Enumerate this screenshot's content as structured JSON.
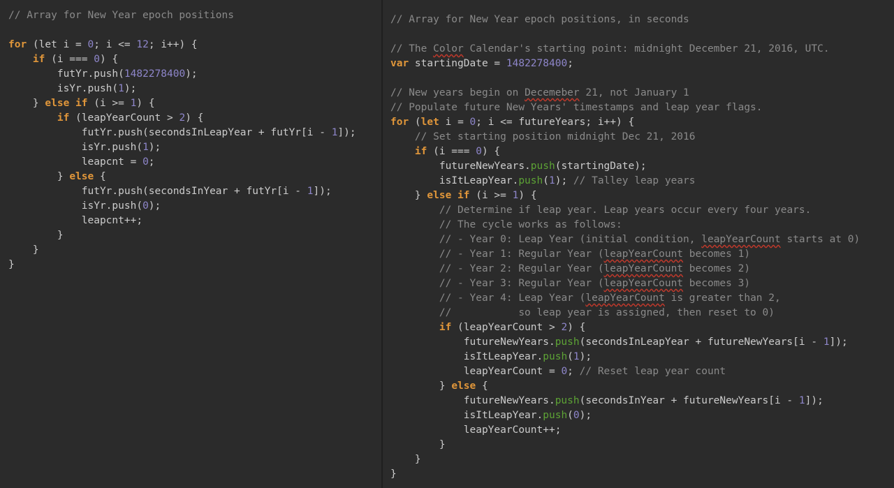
{
  "left_code": [
    [
      [
        "cm",
        "// Array for New Year epoch positions"
      ]
    ],
    [],
    [
      [
        "kw",
        "for"
      ],
      [
        "t",
        " (let i = "
      ],
      [
        "num",
        "0"
      ],
      [
        "t",
        "; i <= "
      ],
      [
        "num",
        "12"
      ],
      [
        "t",
        "; i++) {"
      ]
    ],
    [
      [
        "t",
        "    "
      ],
      [
        "kw",
        "if"
      ],
      [
        "t",
        " (i === "
      ],
      [
        "num",
        "0"
      ],
      [
        "t",
        ") {"
      ]
    ],
    [
      [
        "t",
        "        futYr.push("
      ],
      [
        "num",
        "1482278400"
      ],
      [
        "t",
        ");"
      ]
    ],
    [
      [
        "t",
        "        isYr.push("
      ],
      [
        "num",
        "1"
      ],
      [
        "t",
        ");"
      ]
    ],
    [
      [
        "t",
        "    } "
      ],
      [
        "kw",
        "else"
      ],
      [
        "t",
        " "
      ],
      [
        "kw",
        "if"
      ],
      [
        "t",
        " (i >= "
      ],
      [
        "num",
        "1"
      ],
      [
        "t",
        ") {"
      ]
    ],
    [
      [
        "t",
        "        "
      ],
      [
        "kw",
        "if"
      ],
      [
        "t",
        " (leapYearCount > "
      ],
      [
        "num",
        "2"
      ],
      [
        "t",
        ") {"
      ]
    ],
    [
      [
        "t",
        "            futYr.push(secondsInLeapYear + futYr[i - "
      ],
      [
        "num",
        "1"
      ],
      [
        "t",
        "]);"
      ]
    ],
    [
      [
        "t",
        "            isYr.push("
      ],
      [
        "num",
        "1"
      ],
      [
        "t",
        ");"
      ]
    ],
    [
      [
        "t",
        "            leapcnt = "
      ],
      [
        "num",
        "0"
      ],
      [
        "t",
        ";"
      ]
    ],
    [
      [
        "t",
        "        } "
      ],
      [
        "kw",
        "else"
      ],
      [
        "t",
        " {"
      ]
    ],
    [
      [
        "t",
        "            futYr.push(secondsInYear + futYr[i - "
      ],
      [
        "num",
        "1"
      ],
      [
        "t",
        "]);"
      ]
    ],
    [
      [
        "t",
        "            isYr.push("
      ],
      [
        "num",
        "0"
      ],
      [
        "t",
        ");"
      ]
    ],
    [
      [
        "t",
        "            leapcnt++;"
      ]
    ],
    [
      [
        "t",
        "        }"
      ]
    ],
    [
      [
        "t",
        "    }"
      ]
    ],
    [
      [
        "t",
        "}"
      ]
    ]
  ],
  "right_code": [
    [
      [
        "cm",
        "// Array for New Year epoch positions, in seconds"
      ]
    ],
    [],
    [
      [
        "cm",
        "// The "
      ],
      [
        "cmsq",
        "Color"
      ],
      [
        "cm",
        " Calendar's starting point: midnight December 21, 2016, UTC."
      ]
    ],
    [
      [
        "kw",
        "var"
      ],
      [
        "t",
        " startingDate = "
      ],
      [
        "num",
        "1482278400"
      ],
      [
        "t",
        ";"
      ]
    ],
    [],
    [
      [
        "cm",
        "// New years begin on "
      ],
      [
        "cmsq",
        "Decemeber"
      ],
      [
        "cm",
        " 21, not January 1"
      ]
    ],
    [
      [
        "cm",
        "// Populate future New Years' timestamps and leap year flags."
      ]
    ],
    [
      [
        "kw",
        "for"
      ],
      [
        "t",
        " ("
      ],
      [
        "kw",
        "let"
      ],
      [
        "t",
        " i = "
      ],
      [
        "num",
        "0"
      ],
      [
        "t",
        "; i <= futureYears; i++) {"
      ]
    ],
    [
      [
        "t",
        "    "
      ],
      [
        "cm",
        "// Set starting position midnight Dec 21, 2016"
      ]
    ],
    [
      [
        "t",
        "    "
      ],
      [
        "kw",
        "if"
      ],
      [
        "t",
        " (i === "
      ],
      [
        "num",
        "0"
      ],
      [
        "t",
        ") {"
      ]
    ],
    [
      [
        "t",
        "        futureNewYears."
      ],
      [
        "fn",
        "push"
      ],
      [
        "t",
        "(startingDate);"
      ]
    ],
    [
      [
        "t",
        "        isItLeapYear."
      ],
      [
        "fn",
        "push"
      ],
      [
        "t",
        "("
      ],
      [
        "num",
        "1"
      ],
      [
        "t",
        "); "
      ],
      [
        "cm",
        "// Talley leap years"
      ]
    ],
    [
      [
        "t",
        "    } "
      ],
      [
        "kw",
        "else"
      ],
      [
        "t",
        " "
      ],
      [
        "kw",
        "if"
      ],
      [
        "t",
        " (i >= "
      ],
      [
        "num",
        "1"
      ],
      [
        "t",
        ") {"
      ]
    ],
    [
      [
        "t",
        "        "
      ],
      [
        "cm",
        "// Determine if leap year. Leap years occur every four years."
      ]
    ],
    [
      [
        "t",
        "        "
      ],
      [
        "cm",
        "// The cycle works as follows:"
      ]
    ],
    [
      [
        "t",
        "        "
      ],
      [
        "cm",
        "// - Year 0: Leap Year (initial condition, "
      ],
      [
        "cmsq",
        "leapYearCount"
      ],
      [
        "cm",
        " starts at 0)"
      ]
    ],
    [
      [
        "t",
        "        "
      ],
      [
        "cm",
        "// - Year 1: Regular Year ("
      ],
      [
        "cmsq",
        "leapYearCount"
      ],
      [
        "cm",
        " becomes 1)"
      ]
    ],
    [
      [
        "t",
        "        "
      ],
      [
        "cm",
        "// - Year 2: Regular Year ("
      ],
      [
        "cmsq",
        "leapYearCount"
      ],
      [
        "cm",
        " becomes 2)"
      ]
    ],
    [
      [
        "t",
        "        "
      ],
      [
        "cm",
        "// - Year 3: Regular Year ("
      ],
      [
        "cmsq",
        "leapYearCount"
      ],
      [
        "cm",
        " becomes 3)"
      ]
    ],
    [
      [
        "t",
        "        "
      ],
      [
        "cm",
        "// - Year 4: Leap Year ("
      ],
      [
        "cmsq",
        "leapYearCount"
      ],
      [
        "cm",
        " is greater than 2,"
      ]
    ],
    [
      [
        "t",
        "        "
      ],
      [
        "cm",
        "//           so leap year is assigned, then reset to 0)"
      ]
    ],
    [
      [
        "t",
        "        "
      ],
      [
        "kw",
        "if"
      ],
      [
        "t",
        " (leapYearCount > "
      ],
      [
        "num",
        "2"
      ],
      [
        "t",
        ") {"
      ]
    ],
    [
      [
        "t",
        "            futureNewYears."
      ],
      [
        "fn",
        "push"
      ],
      [
        "t",
        "(secondsInLeapYear + futureNewYears[i - "
      ],
      [
        "num",
        "1"
      ],
      [
        "t",
        "]);"
      ]
    ],
    [
      [
        "t",
        "            isItLeapYear."
      ],
      [
        "fn",
        "push"
      ],
      [
        "t",
        "("
      ],
      [
        "num",
        "1"
      ],
      [
        "t",
        ");"
      ]
    ],
    [
      [
        "t",
        "            leapYearCount = "
      ],
      [
        "num",
        "0"
      ],
      [
        "t",
        "; "
      ],
      [
        "cm",
        "// Reset leap year count"
      ]
    ],
    [
      [
        "t",
        "        } "
      ],
      [
        "kw",
        "else"
      ],
      [
        "t",
        " {"
      ]
    ],
    [
      [
        "t",
        "            futureNewYears."
      ],
      [
        "fn",
        "push"
      ],
      [
        "t",
        "(secondsInYear + futureNewYears[i - "
      ],
      [
        "num",
        "1"
      ],
      [
        "t",
        "]);"
      ]
    ],
    [
      [
        "t",
        "            isItLeapYear."
      ],
      [
        "fn",
        "push"
      ],
      [
        "t",
        "("
      ],
      [
        "num",
        "0"
      ],
      [
        "t",
        ");"
      ]
    ],
    [
      [
        "t",
        "            leapYearCount++;"
      ]
    ],
    [
      [
        "t",
        "        }"
      ]
    ],
    [
      [
        "t",
        "    }"
      ]
    ],
    [
      [
        "t",
        "}"
      ]
    ]
  ],
  "colors": {
    "background": "#2b2b2b",
    "keyword": "#e0963a",
    "number": "#8e86ca",
    "comment": "#8a8a8a",
    "function": "#5da335",
    "text": "#cccccc",
    "spellcheck_underline": "#c0392b"
  }
}
